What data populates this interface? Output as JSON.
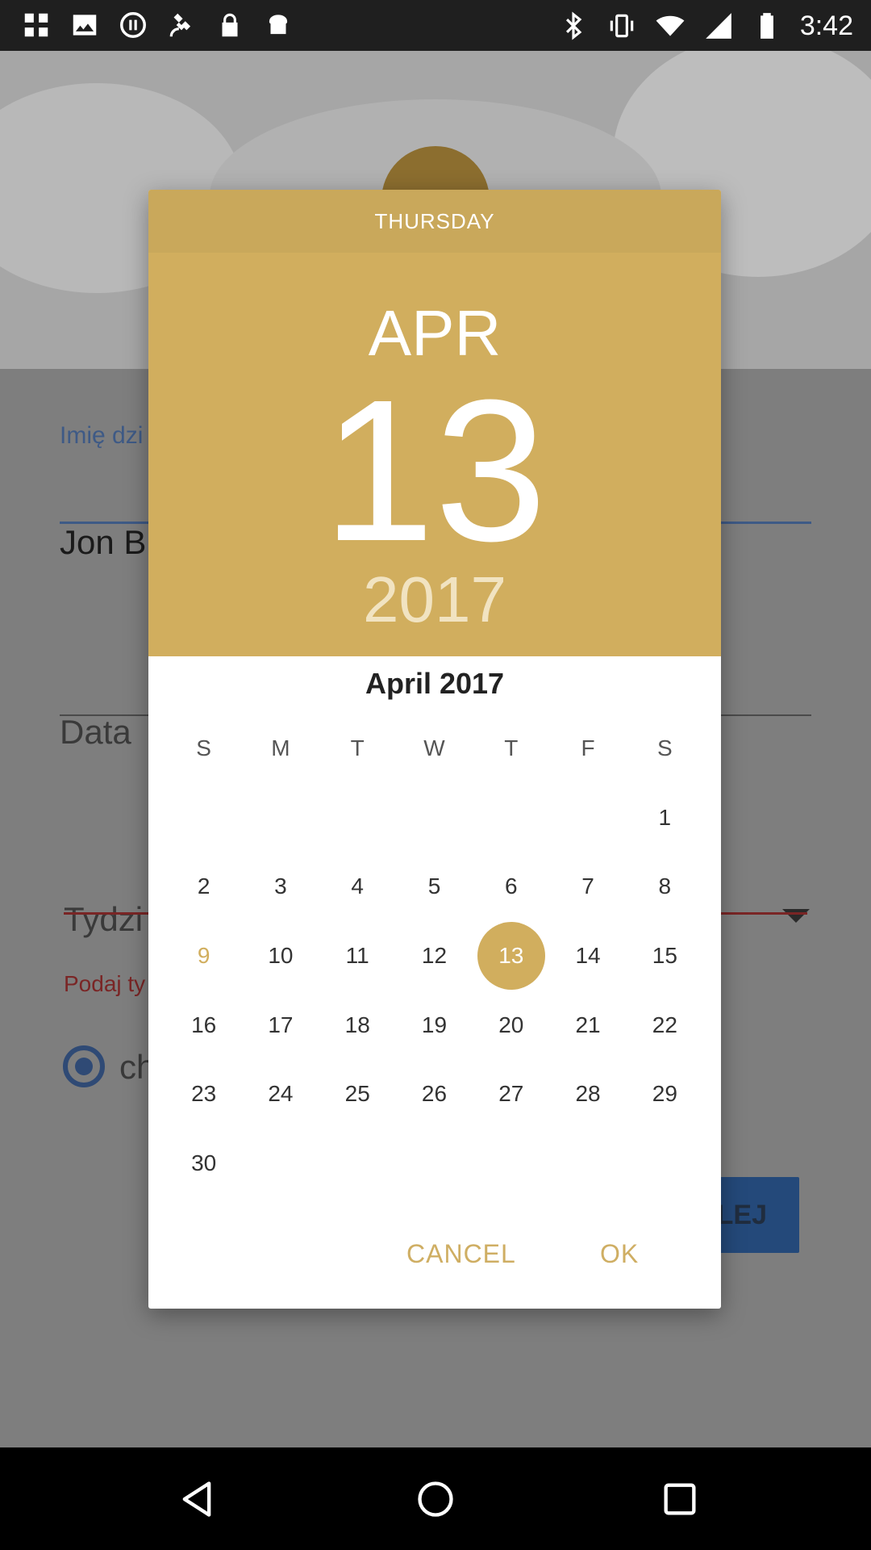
{
  "status_bar": {
    "time": "3:42",
    "left_icons": [
      "grid-icon",
      "image-icon",
      "pause-icon",
      "satellite-icon",
      "lock-icon",
      "toast-icon"
    ],
    "right_icons": [
      "bluetooth-icon",
      "vibrate-icon",
      "wifi-icon",
      "signal-icon",
      "battery-icon"
    ]
  },
  "background_form": {
    "name_label": "Imię dzi",
    "name_value": "Jon B",
    "date_placeholder": "Data",
    "week_placeholder": "Tydzi",
    "week_error": "Podaj ty",
    "radio_label": "ch",
    "next_button": "LEJ"
  },
  "date_picker": {
    "day_of_week": "THURSDAY",
    "header_month": "APR",
    "header_day": "13",
    "header_year": "2017",
    "month_title": "April 2017",
    "weekdays": [
      "S",
      "M",
      "T",
      "W",
      "T",
      "F",
      "S"
    ],
    "weeks": [
      [
        "",
        "",
        "",
        "",
        "",
        "",
        "1"
      ],
      [
        "2",
        "3",
        "4",
        "5",
        "6",
        "7",
        "8"
      ],
      [
        "9",
        "10",
        "11",
        "12",
        "13",
        "14",
        "15"
      ],
      [
        "16",
        "17",
        "18",
        "19",
        "20",
        "21",
        "22"
      ],
      [
        "23",
        "24",
        "25",
        "26",
        "27",
        "28",
        "29"
      ],
      [
        "30",
        "",
        "",
        "",
        "",
        "",
        ""
      ]
    ],
    "selected_day": "13",
    "today_day": "9",
    "cancel_label": "CANCEL",
    "ok_label": "OK",
    "accent_color": "#d1ae5e"
  },
  "nav_bar": {
    "icons": [
      "back-icon",
      "home-icon",
      "recents-icon"
    ]
  }
}
